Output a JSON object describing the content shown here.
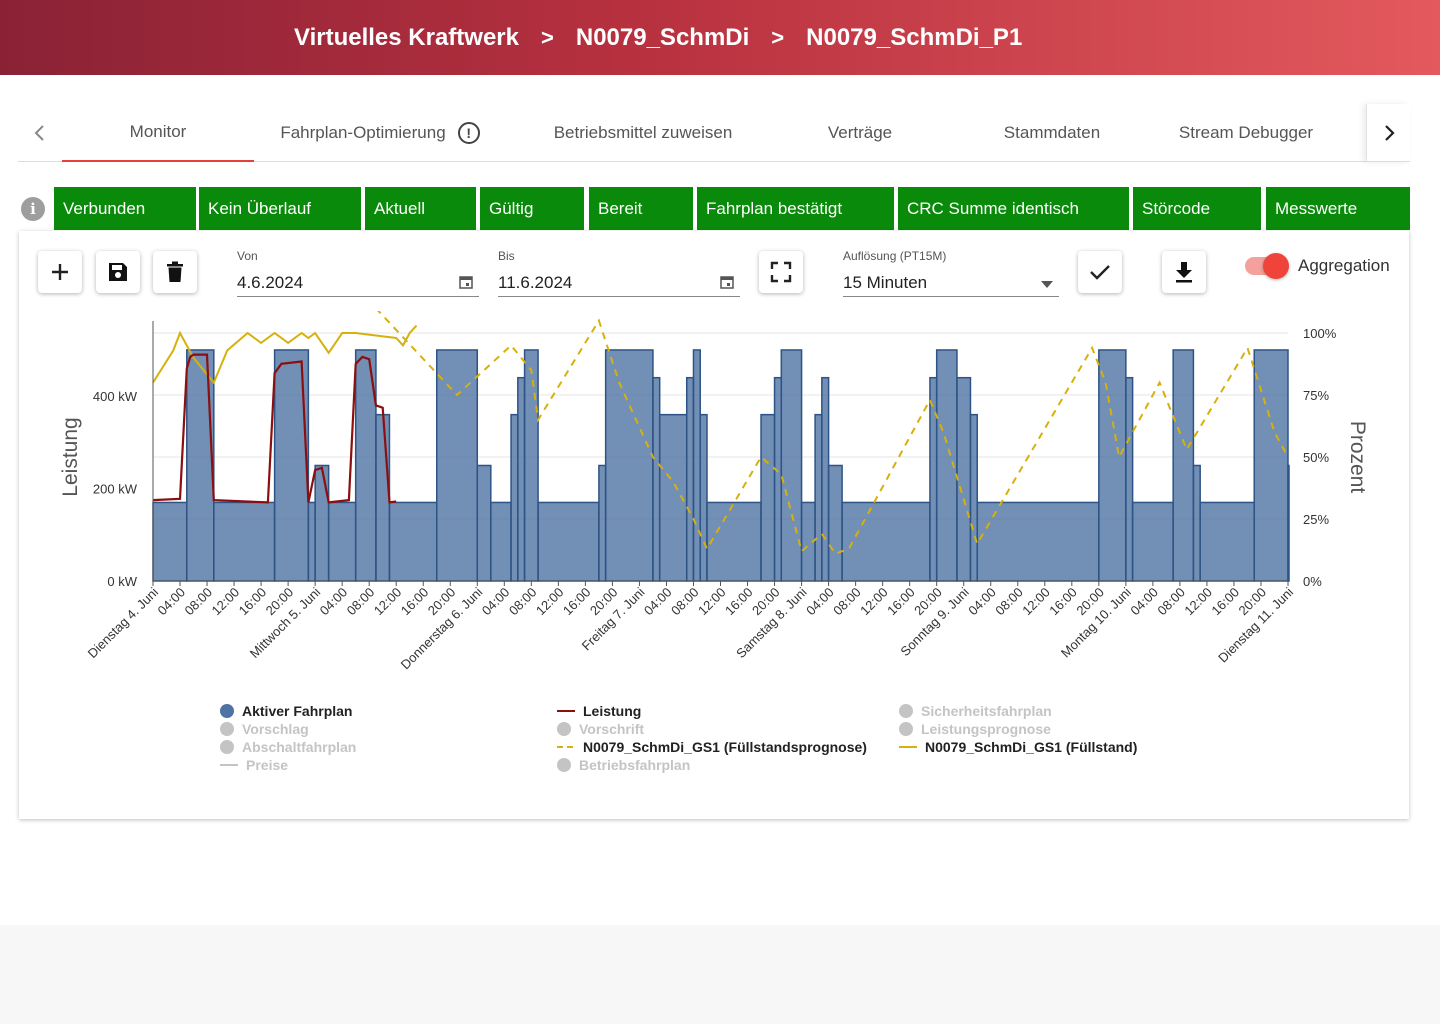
{
  "breadcrumb": [
    "Virtuelles Kraftwerk",
    "N0079_SchmDi",
    "N0079_SchmDi_P1"
  ],
  "breadcrumb_separator": ">",
  "tabs": [
    {
      "label": "Monitor",
      "active": true
    },
    {
      "label": "Fahrplan-Optimierung",
      "icon": "exclamation-circle-icon"
    },
    {
      "label": "Betriebsmittel zuweisen"
    },
    {
      "label": "Verträge"
    },
    {
      "label": "Stammdaten"
    },
    {
      "label": "Stream Debugger"
    }
  ],
  "status_chips": [
    "Verbunden",
    "Kein Überlauf",
    "Aktuell",
    "Gültig",
    "Bereit",
    "Fahrplan bestätigt",
    "CRC Summe identisch",
    "Störcode",
    "Messwerte"
  ],
  "status_color": "#0a8a0a",
  "toolbar": {
    "from_label": "Von",
    "from_value": "4.6.2024",
    "to_label": "Bis",
    "to_value": "11.6.2024",
    "resolution_label": "Auflösung (PT15M)",
    "resolution_value": "15 Minuten",
    "aggregation_label": "Aggregation",
    "aggregation_on": true
  },
  "chart_data": {
    "type": "bar",
    "ylabel_left": "Leistung",
    "ylabel_right": "Prozent",
    "y_ticks_left": [
      "0 kW",
      "200 kW",
      "400 kW"
    ],
    "y_ticks_right": [
      "0%",
      "25%",
      "50%",
      "75%",
      "100%"
    ],
    "ylim_kw": [
      0,
      580
    ],
    "ylim_pct": [
      0,
      100
    ],
    "x_range_hours": [
      0,
      168
    ],
    "x_ticks": [
      "Dienstag 4. Juni",
      "04:00",
      "08:00",
      "12:00",
      "16:00",
      "20:00",
      "Mittwoch 5. Juni",
      "04:00",
      "08:00",
      "12:00",
      "16:00",
      "20:00",
      "Donnerstag 6. Juni",
      "04:00",
      "08:00",
      "12:00",
      "16:00",
      "20:00",
      "Freitag 7. Juni",
      "04:00",
      "08:00",
      "12:00",
      "16:00",
      "20:00",
      "Samstag 8. Juni",
      "04:00",
      "08:00",
      "12:00",
      "16:00",
      "20:00",
      "Sonntag 9. Juni",
      "04:00",
      "08:00",
      "12:00",
      "16:00",
      "20:00",
      "Montag 10. Juni",
      "04:00",
      "08:00",
      "12:00",
      "16:00",
      "20:00",
      "Dienstag 11. Juni"
    ],
    "series": [
      {
        "name": "Aktiver Fahrplan",
        "type": "step-area",
        "color": "#4f73a3",
        "values_hour_kw": [
          [
            0,
            170
          ],
          [
            5,
            500
          ],
          [
            9,
            170
          ],
          [
            18,
            500
          ],
          [
            23,
            170
          ],
          [
            24,
            250
          ],
          [
            26,
            170
          ],
          [
            30,
            500
          ],
          [
            33,
            360
          ],
          [
            35,
            170
          ],
          [
            42,
            500
          ],
          [
            48,
            250
          ],
          [
            50,
            170
          ],
          [
            53,
            360
          ],
          [
            54,
            440
          ],
          [
            55,
            500
          ],
          [
            57,
            170
          ],
          [
            66,
            250
          ],
          [
            67,
            500
          ],
          [
            74,
            440
          ],
          [
            75,
            360
          ],
          [
            79,
            440
          ],
          [
            80,
            500
          ],
          [
            81,
            360
          ],
          [
            82,
            170
          ],
          [
            90,
            360
          ],
          [
            92,
            440
          ],
          [
            93,
            500
          ],
          [
            96,
            170
          ],
          [
            98,
            360
          ],
          [
            99,
            440
          ],
          [
            100,
            250
          ],
          [
            102,
            170
          ],
          [
            115,
            440
          ],
          [
            116,
            500
          ],
          [
            119,
            440
          ],
          [
            121,
            360
          ],
          [
            122,
            170
          ],
          [
            140,
            500
          ],
          [
            144,
            440
          ],
          [
            145,
            170
          ],
          [
            151,
            500
          ],
          [
            154,
            250
          ],
          [
            155,
            170
          ],
          [
            163,
            500
          ],
          [
            168,
            250
          ]
        ]
      },
      {
        "name": "Leistung",
        "type": "line",
        "color": "#8b0f0f",
        "values_hour_kw": [
          [
            0,
            175
          ],
          [
            4,
            178
          ],
          [
            5,
            460
          ],
          [
            5.5,
            485
          ],
          [
            6,
            490
          ],
          [
            8,
            490
          ],
          [
            9,
            175
          ],
          [
            17,
            170
          ],
          [
            18,
            450
          ],
          [
            19,
            470
          ],
          [
            22,
            475
          ],
          [
            23,
            170
          ],
          [
            24,
            240
          ],
          [
            25,
            245
          ],
          [
            26,
            170
          ],
          [
            29,
            175
          ],
          [
            30,
            470
          ],
          [
            31,
            485
          ],
          [
            32,
            480
          ],
          [
            33,
            380
          ],
          [
            34,
            375
          ],
          [
            35,
            170
          ],
          [
            36,
            172
          ]
        ]
      },
      {
        "name": "N0079_SchmDi_GS1 (Füllstandsprognose)",
        "type": "dashed-line",
        "color": "#d6b10d",
        "values_hour_pct": [
          [
            33,
            110
          ],
          [
            45,
            75
          ],
          [
            53,
            95
          ],
          [
            56,
            85
          ],
          [
            57,
            65
          ],
          [
            66,
            105
          ],
          [
            69,
            80
          ],
          [
            74,
            50
          ],
          [
            77,
            40
          ],
          [
            79,
            30
          ],
          [
            80,
            25
          ],
          [
            82,
            13
          ],
          [
            90,
            50
          ],
          [
            93,
            43
          ],
          [
            96,
            12
          ],
          [
            99,
            19
          ],
          [
            101,
            11
          ],
          [
            103,
            13
          ],
          [
            115,
            73
          ],
          [
            117,
            60
          ],
          [
            122,
            15
          ],
          [
            139,
            94
          ],
          [
            141,
            80
          ],
          [
            143,
            50
          ],
          [
            149,
            80
          ],
          [
            153,
            53
          ],
          [
            162,
            94
          ],
          [
            166,
            60
          ],
          [
            168,
            50
          ]
        ]
      },
      {
        "name": "N0079_SchmDi_GS1 (Füllstand)",
        "type": "line",
        "color": "#d6b10d",
        "values_hour_pct": [
          [
            0,
            80
          ],
          [
            3,
            93
          ],
          [
            4,
            100
          ],
          [
            6,
            90
          ],
          [
            9,
            80
          ],
          [
            11,
            93
          ],
          [
            14,
            100
          ],
          [
            16,
            96
          ],
          [
            18,
            100
          ],
          [
            20,
            96
          ],
          [
            22,
            100
          ],
          [
            23,
            98
          ],
          [
            24,
            100
          ],
          [
            26,
            92
          ],
          [
            28,
            100
          ],
          [
            30,
            100
          ],
          [
            33,
            99
          ],
          [
            36,
            98
          ],
          [
            37,
            95
          ],
          [
            38,
            100
          ],
          [
            39,
            103
          ]
        ]
      }
    ]
  },
  "legend": [
    {
      "label": "Aktiver Fahrplan",
      "kind": "dot",
      "color": "#4f73a3",
      "active": true
    },
    {
      "label": "Vorschlag",
      "kind": "dot",
      "color": "#c4c4c4",
      "active": false
    },
    {
      "label": "Abschaltfahrplan",
      "kind": "dot",
      "color": "#c4c4c4",
      "active": false
    },
    {
      "label": "Preise",
      "kind": "line",
      "color": "#c4c4c4",
      "active": false
    },
    {
      "label": "Leistung",
      "kind": "line",
      "color": "#8b0f0f",
      "active": true
    },
    {
      "label": "Vorschrift",
      "kind": "dot",
      "color": "#c4c4c4",
      "active": false
    },
    {
      "label": "N0079_SchmDi_GS1 (Füllstandsprognose)",
      "kind": "dash",
      "color": "#d6b10d",
      "active": true
    },
    {
      "label": "Betriebsfahrplan",
      "kind": "dot",
      "color": "#c4c4c4",
      "active": false
    },
    {
      "label": "Sicherheitsfahrplan",
      "kind": "dot",
      "color": "#c4c4c4",
      "active": false
    },
    {
      "label": "Leistungsprognose",
      "kind": "dot",
      "color": "#c4c4c4",
      "active": false
    },
    {
      "label": "N0079_SchmDi_GS1 (Füllstand)",
      "kind": "line",
      "color": "#d6b10d",
      "active": true
    }
  ]
}
